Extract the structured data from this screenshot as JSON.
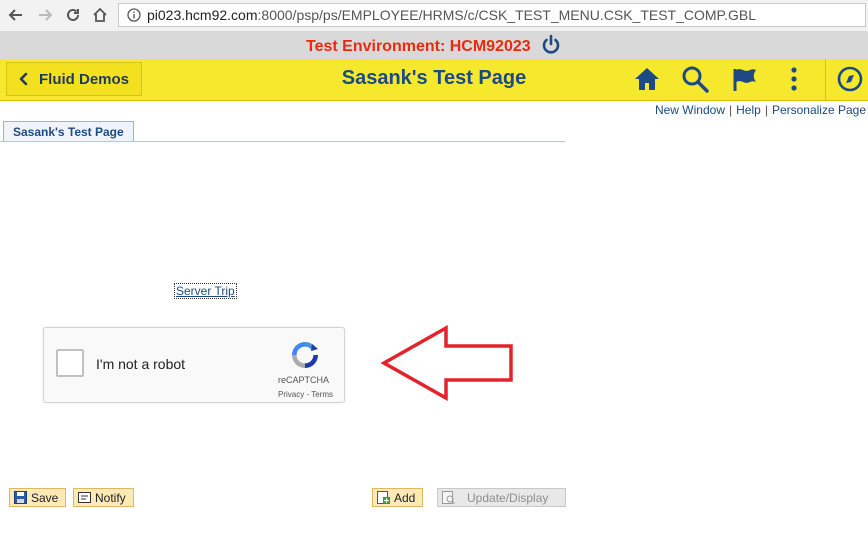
{
  "browser": {
    "url_host": "pi023.hcm92.com",
    "url_rest": ":8000/psp/ps/EMPLOYEE/HRMS/c/CSK_TEST_MENU.CSK_TEST_COMP.GBL"
  },
  "env": {
    "label": "Test Environment: HCM92023"
  },
  "header": {
    "back_label": "Fluid Demos",
    "title": "Sasank's Test Page",
    "icons": [
      "home-icon",
      "search-icon",
      "flag-icon",
      "more-icon",
      "navbar-compass-icon"
    ]
  },
  "links": {
    "new_window": "New Window",
    "help": "Help",
    "personalize": "Personalize Page"
  },
  "tab": {
    "label": "Sasank's Test Page"
  },
  "content": {
    "server_trip": "Server Trip"
  },
  "recaptcha": {
    "label": "I'm not a robot",
    "brand": "reCAPTCHA",
    "privacy": "Privacy",
    "terms_sep": " - ",
    "terms": "Terms"
  },
  "buttons": {
    "save": "Save",
    "notify": "Notify",
    "add": "Add",
    "update_display": "Update/Display"
  },
  "colors": {
    "header_bg": "#f6e92d",
    "title": "#1d4a84",
    "env_text": "#e82b0f",
    "arrow": "#e3232c"
  }
}
